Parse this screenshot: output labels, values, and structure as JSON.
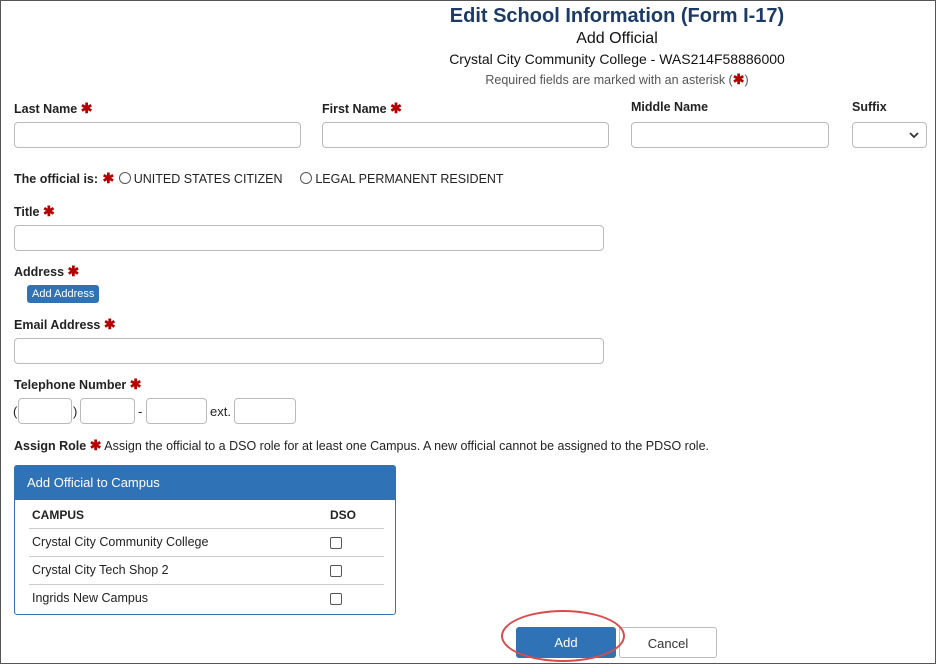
{
  "header": {
    "title": "Edit School Information (Form I-17)",
    "subtitle": "Add Official",
    "school": "Crystal City Community College - WAS214F58886000",
    "required_note_prefix": "Required fields are marked with an asterisk (",
    "required_note_suffix": ")"
  },
  "asterisk": "✱",
  "fields": {
    "last_name_label": "Last Name",
    "first_name_label": "First Name",
    "middle_name_label": "Middle Name",
    "suffix_label": "Suffix",
    "official_is_label": "The official is:",
    "citizen_option": "UNITED STATES CITIZEN",
    "resident_option": "LEGAL PERMANENT RESIDENT",
    "title_label": "Title",
    "address_label": "Address",
    "add_address_button": "Add Address",
    "email_label": "Email Address",
    "telephone_label": "Telephone Number",
    "paren_open": "(",
    "paren_close": ")",
    "dash": "-",
    "ext_label": "ext.",
    "assign_role_label": "Assign Role",
    "assign_role_text": "Assign the official to a DSO role for at least one Campus. A new official cannot be assigned to the PDSO role."
  },
  "panel": {
    "title": "Add Official to Campus",
    "col_campus": "CAMPUS",
    "col_dso": "DSO",
    "rows": [
      {
        "campus": "Crystal City Community College"
      },
      {
        "campus": "Crystal City Tech Shop 2"
      },
      {
        "campus": "Ingrids New Campus"
      }
    ]
  },
  "actions": {
    "add_label": "Add",
    "cancel_label": "Cancel"
  },
  "colors": {
    "title": "#1b3a66",
    "primary": "#2f72b6",
    "required": "#b50000",
    "highlight": "#d94c4c"
  }
}
